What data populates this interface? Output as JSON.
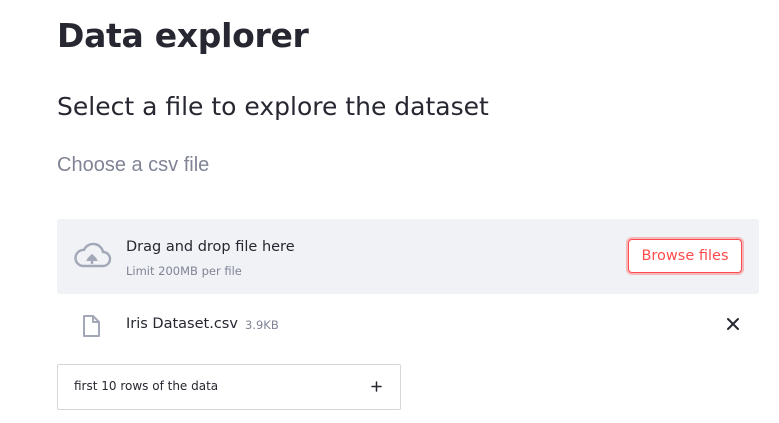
{
  "page": {
    "title": "Data explorer",
    "subtitle": "Select a file to explore the dataset"
  },
  "uploader": {
    "label": "Choose a csv file",
    "drop_text": "Drag and drop file here",
    "limit_text": "Limit 200MB per file",
    "browse_label": "Browse files",
    "icon": "cloud-upload-icon"
  },
  "uploaded_file": {
    "name": "Iris Dataset.csv",
    "size": "3.9KB",
    "icon": "file-icon",
    "remove_icon": "close-icon"
  },
  "expander": {
    "label": "first 10 rows of the data",
    "icon": "plus-icon"
  },
  "colors": {
    "accent": "#ff4b4b",
    "dropzone_bg": "#f0f2f6",
    "muted_text": "#808495",
    "icon_gray": "#a3a8b8"
  }
}
